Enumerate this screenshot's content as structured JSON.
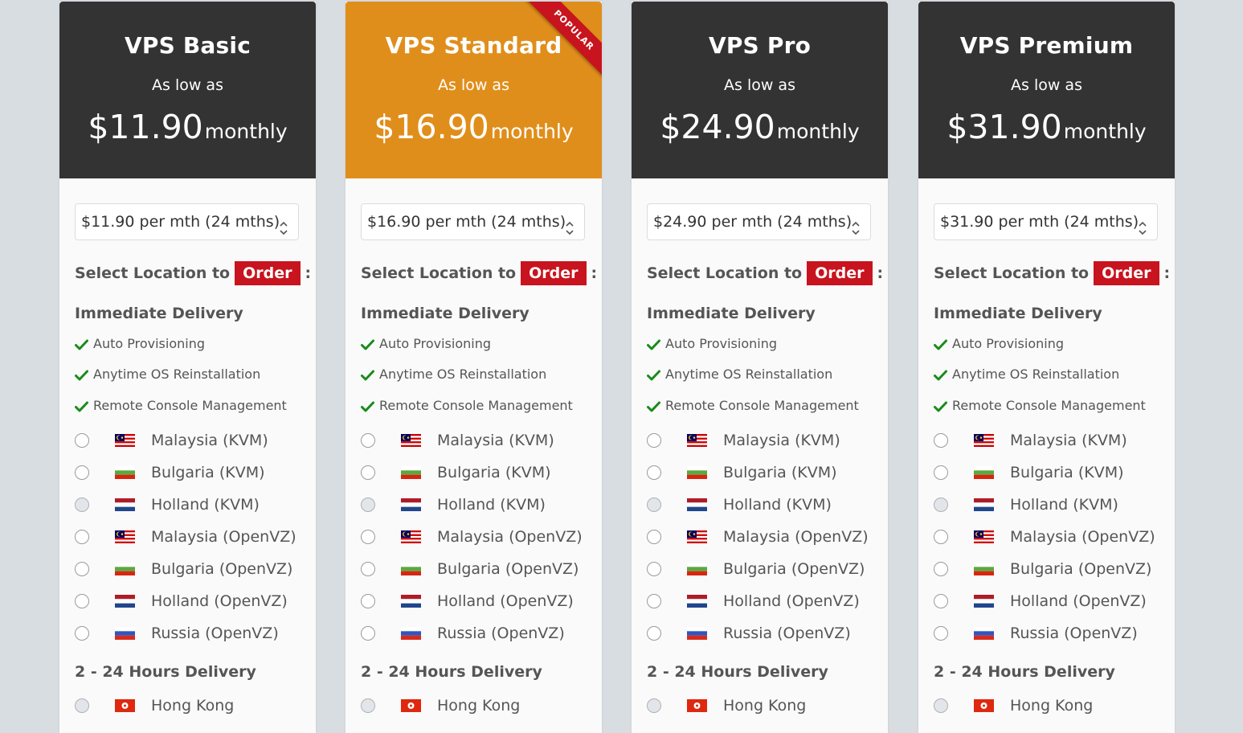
{
  "plans": [
    {
      "name": "VPS Basic",
      "as_low_as": "As low as",
      "price": "$11.90",
      "period": "monthly",
      "term_select": "$11.90 per mth (24 mths)",
      "popular": false
    },
    {
      "name": "VPS Standard",
      "as_low_as": "As low as",
      "price": "$16.90",
      "period": "monthly",
      "term_select": "$16.90 per mth (24 mths)",
      "popular": true,
      "ribbon": "POPULAR"
    },
    {
      "name": "VPS Pro",
      "as_low_as": "As low as",
      "price": "$24.90",
      "period": "monthly",
      "term_select": "$24.90 per mth (24 mths)",
      "popular": false
    },
    {
      "name": "VPS Premium",
      "as_low_as": "As low as",
      "price": "$31.90",
      "period": "monthly",
      "term_select": "$31.90 per mth (24 mths)",
      "popular": false
    }
  ],
  "order": {
    "prefix": "Select Location to",
    "button": "Order",
    "suffix": ":"
  },
  "immediate": {
    "title": "Immediate Delivery",
    "features": [
      "Auto Provisioning",
      "Anytime OS Reinstallation",
      "Remote Console Management"
    ],
    "locations": [
      {
        "label": "Malaysia (KVM)",
        "flag": "malaysia-flag-icon",
        "state": "enabled"
      },
      {
        "label": "Bulgaria (KVM)",
        "flag": "bulgaria-flag-icon",
        "state": "enabled"
      },
      {
        "label": "Holland (KVM)",
        "flag": "holland-flag-icon",
        "state": "disabled"
      },
      {
        "label": "Malaysia (OpenVZ)",
        "flag": "malaysia-flag-icon",
        "state": "enabled"
      },
      {
        "label": "Bulgaria (OpenVZ)",
        "flag": "bulgaria-flag-icon",
        "state": "enabled"
      },
      {
        "label": "Holland (OpenVZ)",
        "flag": "holland-flag-icon",
        "state": "enabled"
      },
      {
        "label": "Russia (OpenVZ)",
        "flag": "russia-flag-icon",
        "state": "enabled"
      }
    ]
  },
  "delayed": {
    "title": "2 - 24 Hours Delivery",
    "locations": [
      {
        "label": "Hong Kong",
        "flag": "hongkong-flag-icon",
        "state": "disabled"
      }
    ]
  },
  "colors": {
    "background": "#d8dde1",
    "card_header_dark": "#333333",
    "card_header_popular": "#e08e1b",
    "accent_red": "#c8141e",
    "check_green": "#1a8a1a"
  }
}
